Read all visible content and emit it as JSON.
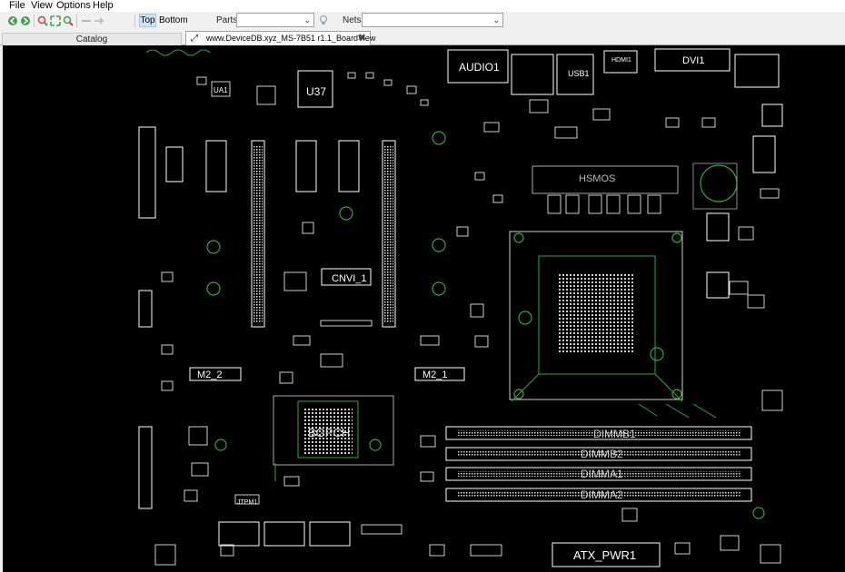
{
  "menu": [
    "File",
    "View",
    "Options",
    "Help"
  ],
  "toolbar": {
    "top_label": "Top",
    "bottom_label": "Bottom",
    "parts_label": "Parts:",
    "parts_value": "",
    "nets_label": "Nets:",
    "nets_value": ""
  },
  "tabs": {
    "catalog": "Catalog",
    "document": "www.DeviceDB.xyz_MS-7B51 r1.1_BoardView"
  },
  "board": {
    "labels": {
      "audio": "AUDIO1",
      "usb": "USB1",
      "hdmi": "HDMI1",
      "dvi": "DVI1",
      "u37": "U37",
      "ua1": "UA1",
      "cnvi": "CNVI_1",
      "m2_2": "M2_2",
      "m2_1": "M2_1",
      "pch": "BGPCH",
      "dimmb1": "DIMMB1",
      "dimmb2": "DIMMB2",
      "dimma1": "DIMMA1",
      "dimma2": "DIMMA2",
      "atx": "ATX_PWR1",
      "hsmos": "HSMOS",
      "jtpm": "JTPM1"
    }
  },
  "colors": {
    "outline": "#ffffff",
    "trace": "#2fa83a",
    "canvas": "#000000"
  }
}
